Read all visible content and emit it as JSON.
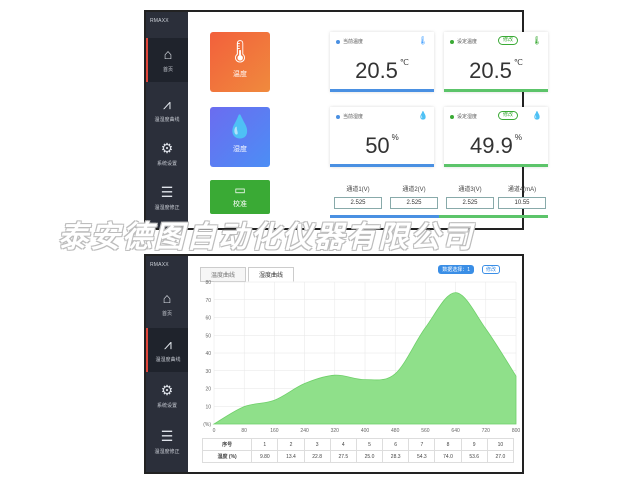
{
  "brand": "RMAXX",
  "nav": [
    {
      "label": "首页",
      "icon": "home-icon"
    },
    {
      "label": "温湿度曲线",
      "icon": "line-chart-icon"
    },
    {
      "label": "系统设置",
      "icon": "gear-icon"
    },
    {
      "label": "温湿度修正",
      "icon": "sliders-icon"
    }
  ],
  "dashboard": {
    "temp_tile": "温度",
    "hum_tile": "湿度",
    "cal_tile": "校准",
    "cards": [
      {
        "label": "当前温度",
        "value": "20.5",
        "unit": "℃",
        "dot": "#4a90e2"
      },
      {
        "label": "设定温度",
        "value": "20.5",
        "unit": "℃",
        "dot": "#3aaa35",
        "edit": "修改"
      },
      {
        "label": "当前湿度",
        "value": "50",
        "unit": "%",
        "dot": "#4a90e2"
      },
      {
        "label": "设定湿度",
        "value": "49.9",
        "unit": "%",
        "dot": "#3aaa35",
        "edit": "修改"
      }
    ],
    "channels": [
      {
        "label": "通道1(V)",
        "value": "2.525"
      },
      {
        "label": "通道2(V)",
        "value": "2.525"
      },
      {
        "label": "通道3(V)",
        "value": "2.525"
      },
      {
        "label": "通道4(mA)",
        "value": "10.55"
      }
    ]
  },
  "curve": {
    "tabs": [
      "温度曲线",
      "湿度曲线"
    ],
    "select_label": "数据选择：1",
    "edit_label": "修改",
    "table_headers": {
      "index": "序号",
      "humidity": "湿度"
    },
    "humidity_unit": "(%)",
    "indices": [
      "1",
      "2",
      "3",
      "4",
      "5",
      "6",
      "7",
      "8",
      "9",
      "10"
    ],
    "humidity_values": [
      "9.80",
      "13.4",
      "22.8",
      "27.5",
      "25.0",
      "28.3",
      "54.3",
      "74.0",
      "53.6",
      "27.0"
    ]
  },
  "chart_data": {
    "type": "area",
    "x": [
      0,
      80,
      160,
      240,
      320,
      400,
      480,
      560,
      640,
      720,
      800
    ],
    "y_series": [
      {
        "values": [
          0,
          9.8,
          13.4,
          22.8,
          27.5,
          25.0,
          28.3,
          54.3,
          74.0,
          53.6,
          27.0
        ]
      }
    ],
    "ylabel": "(%)",
    "ylim": [
      0,
      80
    ],
    "xlim": [
      0,
      800
    ],
    "y_ticks": [
      "80",
      "70",
      "60",
      "50",
      "40",
      "30",
      "20",
      "10",
      "(%)"
    ],
    "x_ticks": [
      "0",
      "80",
      "160",
      "240",
      "320",
      "400",
      "480",
      "560",
      "640",
      "720",
      "800"
    ],
    "grid": true,
    "fill_color": "#8fe08a"
  },
  "watermark": "泰安德图自动化仪器有限公司"
}
